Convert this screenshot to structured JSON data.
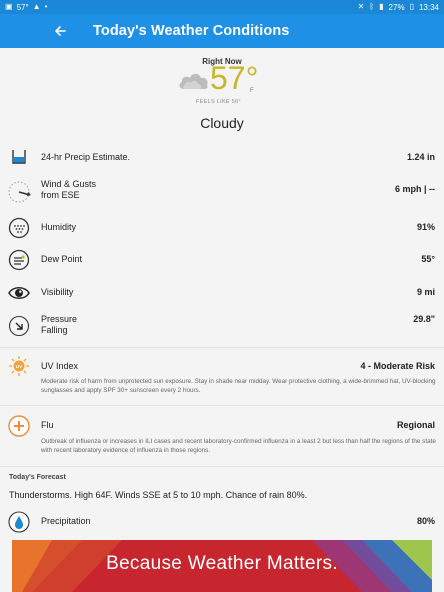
{
  "status_bar": {
    "left_text": "57°",
    "battery": "27%",
    "time": "13:34"
  },
  "appbar": {
    "title": "Today's Weather Conditions",
    "back_icon": "arrow-left-icon"
  },
  "current": {
    "right_now_label": "Right Now",
    "temperature": "57°",
    "unit": "F",
    "feels_like": "FEELS LIKE 56°",
    "condition": "Cloudy",
    "icon": "cloud-icon"
  },
  "details": [
    {
      "icon": "precip-cup-icon",
      "label": "24-hr Precip Estimate.",
      "value": "1.24 in"
    },
    {
      "icon": "wind-icon",
      "label": "Wind & Gusts",
      "sublabel": "from ESE",
      "value": "6 mph | --"
    },
    {
      "icon": "humidity-icon",
      "label": "Humidity",
      "value": "91%"
    },
    {
      "icon": "dew-point-icon",
      "label": "Dew Point",
      "value": "55°"
    },
    {
      "icon": "eye-icon",
      "label": "Visibility",
      "value": "9 mi"
    },
    {
      "icon": "pressure-arrow-icon",
      "label": "Pressure",
      "sublabel": "Falling",
      "value": "29.8\""
    },
    {
      "icon": "uv-icon",
      "label": "UV Index",
      "value": "4 - Moderate Risk",
      "description": "Moderate risk of harm from unprotected sun exposure. Stay in shade near midday. Wear protective clothing, a wide-brimmed hat, UV-blocking sunglasses and apply SPF 30+ sunscreen every 2 hours."
    },
    {
      "icon": "flu-plus-icon",
      "label": "Flu",
      "value": "Regional",
      "description": "Outbreak of influenza or increases in ILI cases and recent laboratory-confirmed influenza in a least 2 but less than half the regions of the state with recent laboratory evidence of influenza in those regions."
    }
  ],
  "forecast": {
    "heading": "Today's Forecast",
    "text": "Thunderstorms. High 64F. Winds SSE at 5 to 10 mph. Chance of rain 80%.",
    "precip_label": "Precipitation",
    "precip_value": "80%",
    "precip_icon": "raindrop-icon"
  },
  "banner": {
    "text": "Because Weather Matters."
  },
  "colors": {
    "appbar": "#1e90e6",
    "statusbar": "#1a88d6",
    "temperature": "#c6b72b",
    "uv": "#f2a33a",
    "flu": "#f0893a",
    "precip_blue": "#1e88d0"
  }
}
